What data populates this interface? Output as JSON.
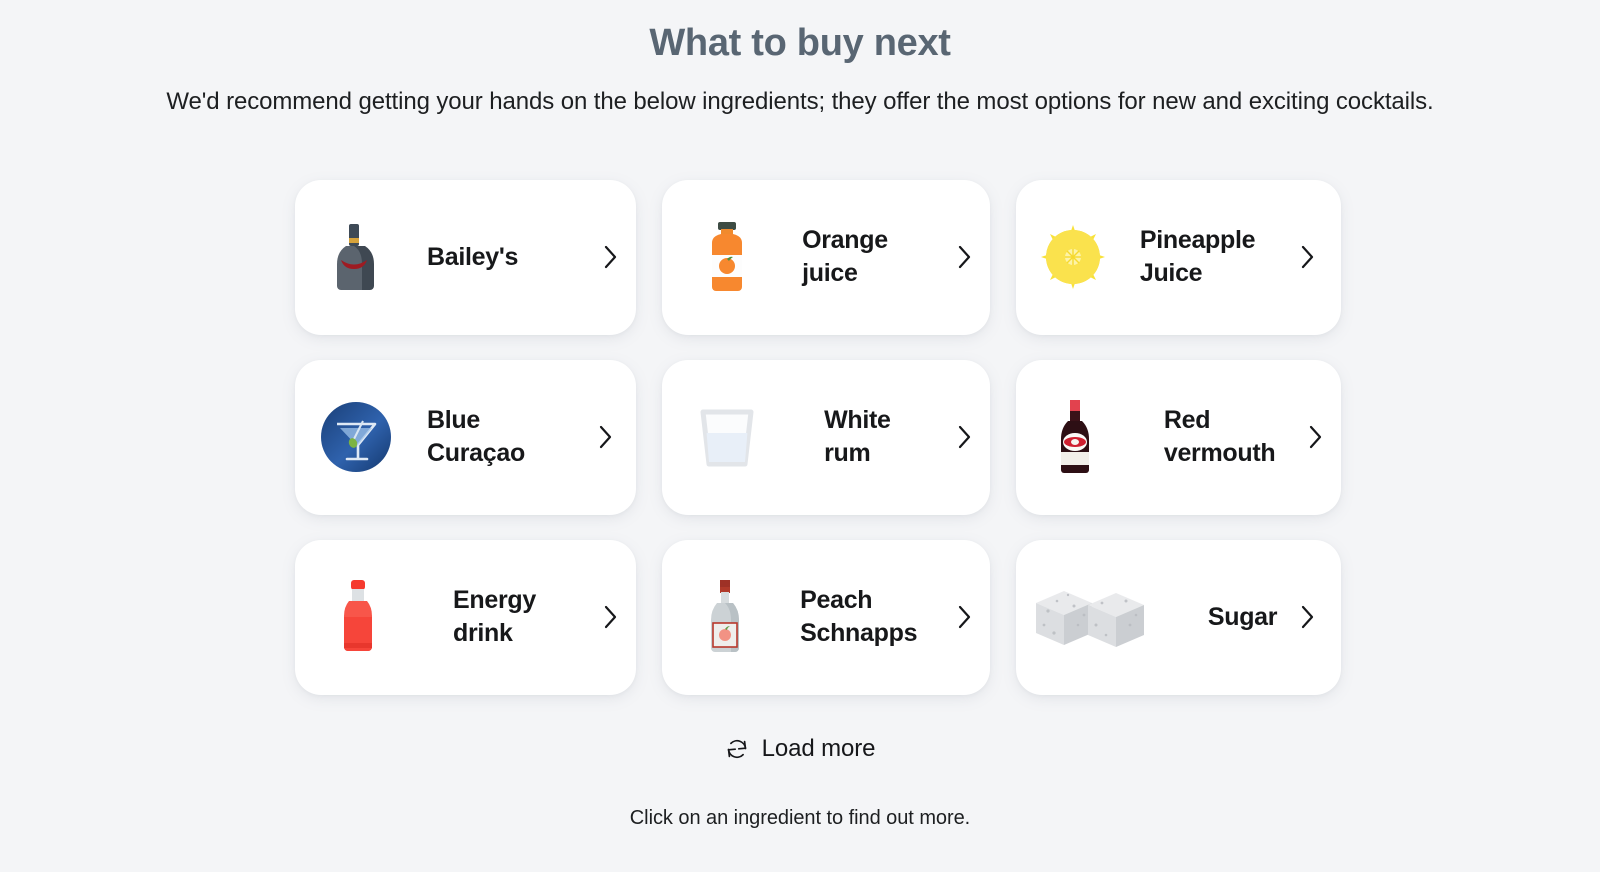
{
  "header": {
    "title": "What to buy next",
    "subtitle": "We'd recommend getting your hands on the below ingredients; they offer the most options for new and exciting cocktails."
  },
  "colors": {
    "page_background": "#f4f5f7",
    "card_background": "#ffffff",
    "title_text": "#596673",
    "body_text": "#1d1f21",
    "label_text": "#17181a"
  },
  "ingredients": [
    {
      "label": "Bailey's",
      "icon": "liqueur-bottle-icon",
      "chevron": "chevron-right-icon",
      "wrap": false
    },
    {
      "label": "Orange\njuice",
      "icon": "orange-juice-bottle-icon",
      "chevron": "chevron-right-icon",
      "wrap": true
    },
    {
      "label": "Pineapple\nJuice",
      "icon": "pineapple-juice-icon",
      "chevron": "chevron-right-icon",
      "wrap": true
    },
    {
      "label": "Blue\nCuraçao",
      "icon": "cocktail-glass-icon",
      "chevron": "chevron-right-icon",
      "wrap": true
    },
    {
      "label": "White rum",
      "icon": "clear-glass-icon",
      "chevron": "chevron-right-icon",
      "wrap": false
    },
    {
      "label": "Red vermouth",
      "icon": "vermouth-bottle-icon",
      "chevron": "chevron-right-icon",
      "wrap": false
    },
    {
      "label": "Energy drink",
      "icon": "energy-drink-bottle-icon",
      "chevron": "chevron-right-icon",
      "wrap": false
    },
    {
      "label": "Peach Schnapps",
      "icon": "schnapps-bottle-icon",
      "chevron": "chevron-right-icon",
      "wrap": false
    },
    {
      "label": "Sugar",
      "icon": "sugar-cubes-icon",
      "chevron": "chevron-right-icon",
      "wrap": false
    }
  ],
  "load_more": {
    "label": "Load more",
    "icon": "refresh-icon"
  },
  "footer": {
    "note": "Click on an ingredient to find out more."
  }
}
